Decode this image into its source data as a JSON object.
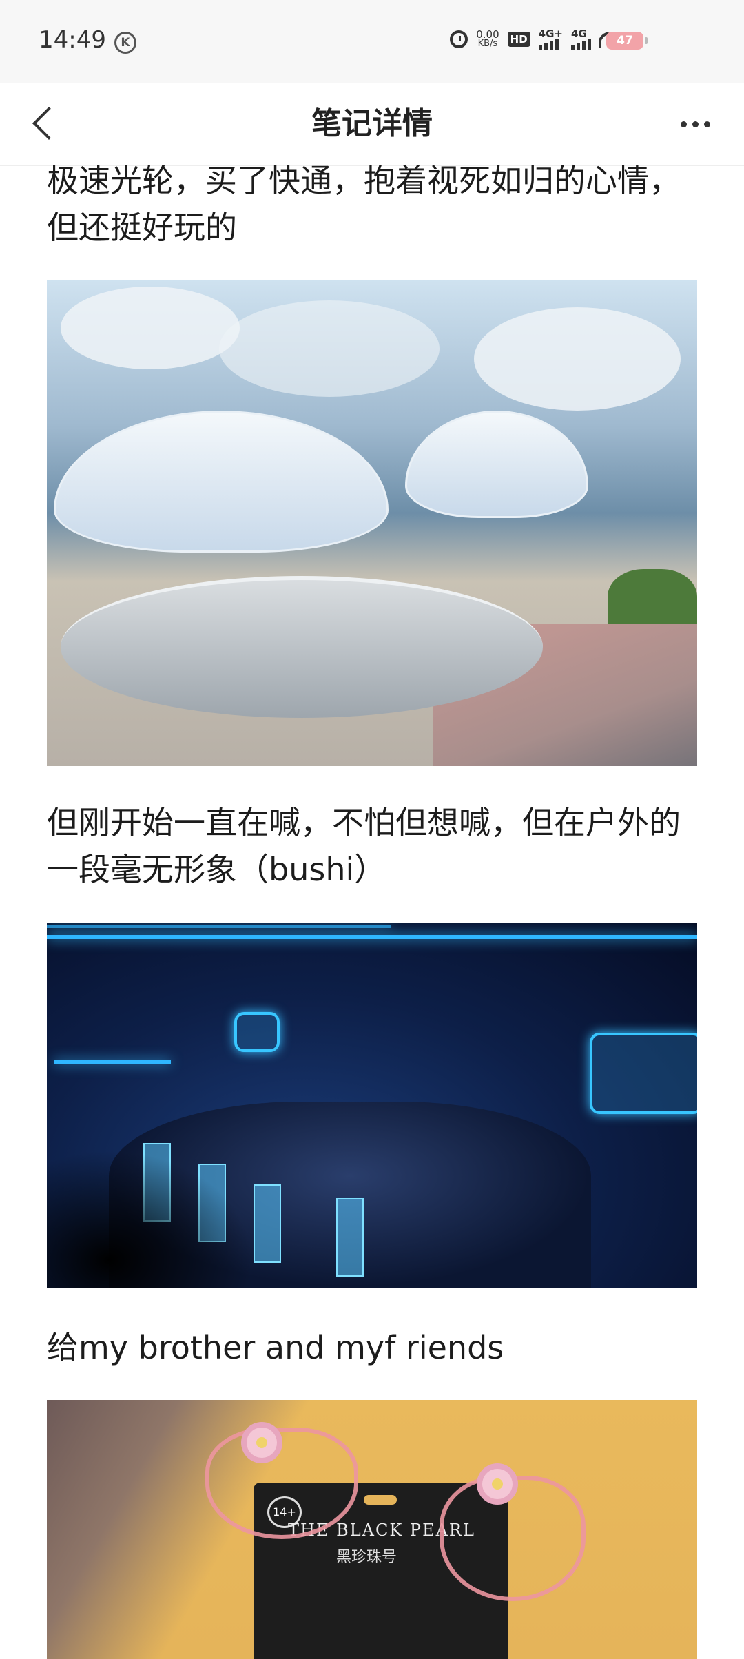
{
  "status_bar": {
    "time": "14:49",
    "k_badge": "K",
    "net_speed": "0.00",
    "net_unit": "KB/s",
    "hd": "HD",
    "sim1": "4G+",
    "sim2": "4G",
    "battery": "47"
  },
  "header": {
    "title": "笔记详情"
  },
  "content": {
    "para1": "极速光轮，买了快通，抱着视死如归的心情，但还挺好玩的",
    "para2": "但刚开始一直在喊，不怕但想喊，但在户外的一段毫无形象（bushi）",
    "para3": "给my brother and myf riends"
  },
  "photo3": {
    "age_badge": "14+",
    "brand": "THE BLACK PEARL",
    "brand_cn": "黑珍珠号"
  },
  "colors": {
    "background": "#ffffff",
    "statusbar_bg": "#f7f7f7",
    "battery": "#f2a3a8",
    "neon_blue": "#2fb6ff"
  }
}
